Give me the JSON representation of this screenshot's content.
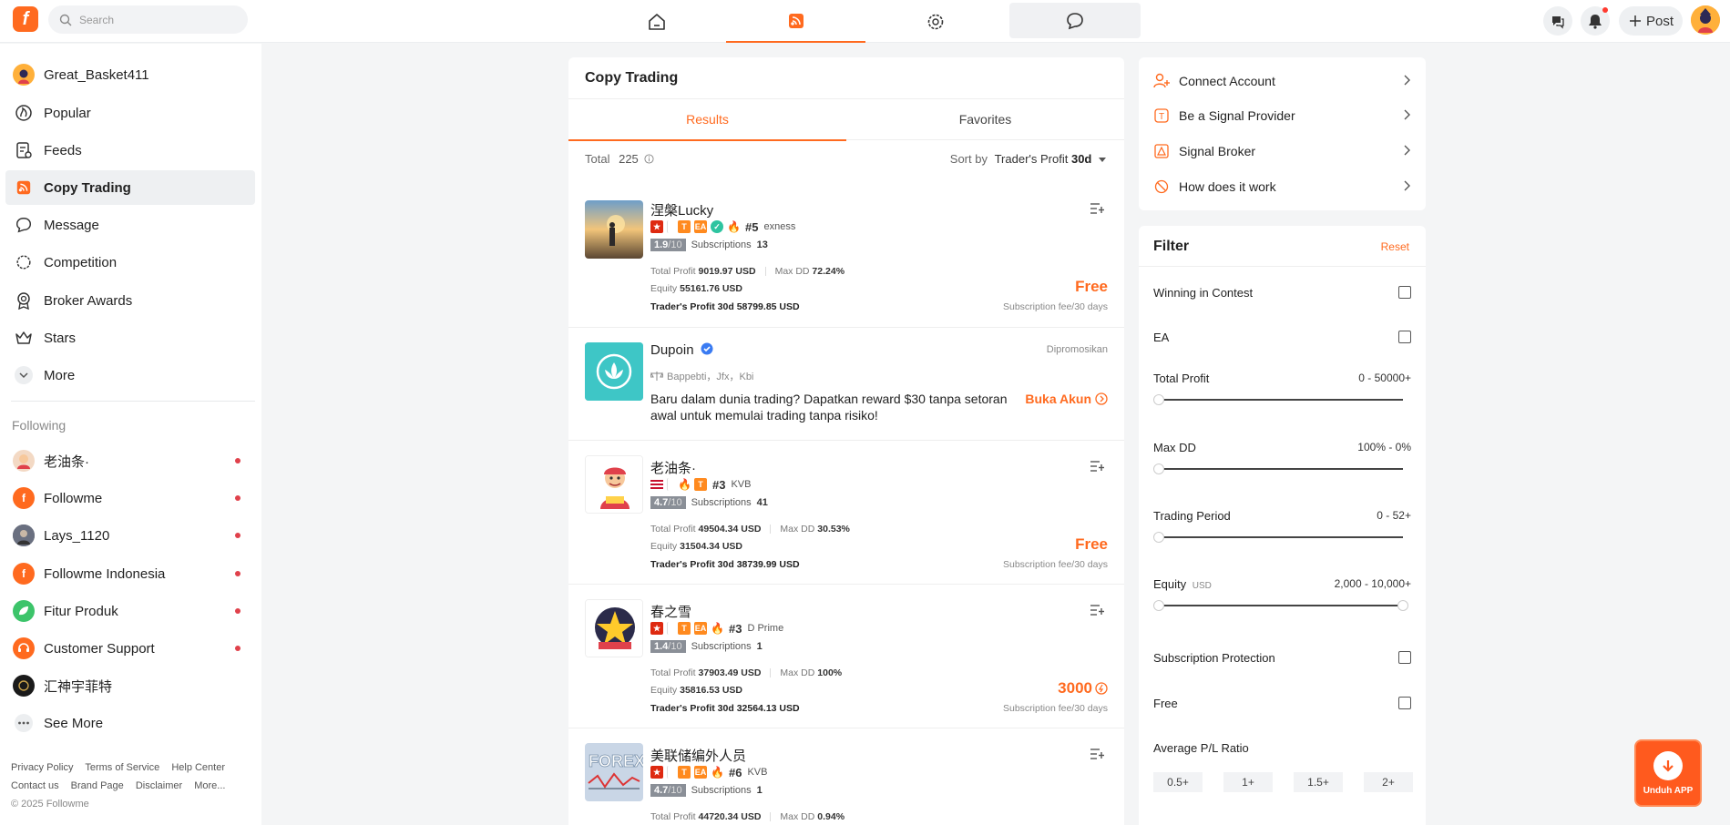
{
  "topbar": {
    "logo": "f",
    "search_placeholder": "Search",
    "post_label": "Post"
  },
  "sidebar": {
    "user": "Great_Basket411",
    "items": [
      {
        "label": "Popular",
        "icon": "popular-icon"
      },
      {
        "label": "Feeds",
        "icon": "feeds-icon"
      },
      {
        "label": "Copy Trading",
        "icon": "copy-trading-icon"
      },
      {
        "label": "Message",
        "icon": "message-icon"
      },
      {
        "label": "Competition",
        "icon": "competition-icon"
      },
      {
        "label": "Broker Awards",
        "icon": "award-icon"
      },
      {
        "label": "Stars",
        "icon": "crown-icon"
      },
      {
        "label": "More",
        "icon": "chevron-down-icon"
      }
    ],
    "following_title": "Following",
    "following": [
      {
        "label": "老油条·",
        "color": "#f3d9c4"
      },
      {
        "label": "Followme",
        "color": "#ff6a1f"
      },
      {
        "label": "Lays_1120",
        "color": "#555b66"
      },
      {
        "label": "Followme Indonesia",
        "color": "#ff6a1f"
      },
      {
        "label": "Fitur Produk",
        "color": "#3cc46a"
      },
      {
        "label": "Customer Support",
        "color": "#ff6a1f"
      },
      {
        "label": "汇神宇菲特",
        "color": "#1a1a1a"
      }
    ],
    "see_more": "See More",
    "footer_row1": [
      "Privacy Policy",
      "Terms of Service",
      "Help Center"
    ],
    "footer_row2": [
      "Contact us",
      "Brand Page",
      "Disclaimer",
      "More..."
    ],
    "copyright": "© 2025 Followme"
  },
  "main": {
    "title": "Copy Trading",
    "tabs": [
      "Results",
      "Favorites"
    ],
    "total_label": "Total",
    "total_value": "225",
    "sort_label": "Sort by",
    "sort_value": "Trader's Profit",
    "sort_period": "30d",
    "traders": [
      {
        "name": "涅槃Lucky",
        "rank": "#5",
        "broker": "exness",
        "score": "1.9",
        "score_max": "/10",
        "subs_label": "Subscriptions",
        "subs": "13",
        "total_profit": "9019.97 USD",
        "max_dd": "72.24%",
        "equity": "55161.76 USD",
        "trader_profit": "58799.85 USD",
        "price": "Free",
        "fee_note": "Subscription fee/30 days"
      },
      {
        "name": "老油条·",
        "rank": "#3",
        "broker": "KVB",
        "score": "4.7",
        "score_max": "/10",
        "subs_label": "Subscriptions",
        "subs": "41",
        "total_profit": "49504.34 USD",
        "max_dd": "30.53%",
        "equity": "31504.34 USD",
        "trader_profit": "38739.99 USD",
        "price": "Free",
        "fee_note": "Subscription fee/30 days"
      },
      {
        "name": "春之雪",
        "rank": "#3",
        "broker": "D Prime",
        "score": "1.4",
        "score_max": "/10",
        "subs_label": "Subscriptions",
        "subs": "1",
        "total_profit": "37903.49 USD",
        "max_dd": "100%",
        "equity": "35816.53 USD",
        "trader_profit": "32564.13 USD",
        "price": "3000",
        "fee_note": "Subscription fee/30 days"
      },
      {
        "name": "美联储编外人员",
        "rank": "#6",
        "broker": "KVB",
        "score": "4.7",
        "score_max": "/10",
        "subs_label": "Subscriptions",
        "subs": "1",
        "total_profit": "44720.34 USD",
        "max_dd": "0.94%"
      }
    ],
    "labels": {
      "total_profit": "Total Profit",
      "max_dd": "Max DD",
      "equity": "Equity",
      "trader_profit": "Trader's Profit 30d"
    },
    "ad": {
      "name": "Dupoin",
      "promo": "Dipromosikan",
      "regs": "Bappebti，Jfx，Kbi",
      "text": "Baru dalam dunia trading? Dapatkan reward $30 tanpa setoran awal untuk memulai trading tanpa risiko!",
      "cta": "Buka Akun"
    }
  },
  "right": {
    "links": [
      {
        "label": "Connect Account",
        "icon": "add-user-icon"
      },
      {
        "label": "Be a Signal Provider",
        "icon": "signal-provider-icon"
      },
      {
        "label": "Signal Broker",
        "icon": "broker-icon"
      },
      {
        "label": "How does it work",
        "icon": "help-icon"
      }
    ],
    "filter": {
      "title": "Filter",
      "reset": "Reset",
      "winning": "Winning in Contest",
      "ea": "EA",
      "total_profit": "Total Profit",
      "total_profit_range": "0 - 50000+",
      "max_dd": "Max DD",
      "max_dd_range": "100% - 0%",
      "trading_period": "Trading Period",
      "trading_period_range": "0 - 52+",
      "equity": "Equity",
      "equity_unit": "USD",
      "equity_range": "2,000 - 10,000+",
      "sub_protection": "Subscription Protection",
      "free": "Free",
      "avg_pl": "Average P/L Ratio",
      "chips": [
        "0.5+",
        "1+",
        "1.5+",
        "2+"
      ]
    }
  },
  "app_button": "Unduh APP",
  "colors": {
    "accent": "#ff6a1f",
    "bg": "#f4f5f6"
  }
}
